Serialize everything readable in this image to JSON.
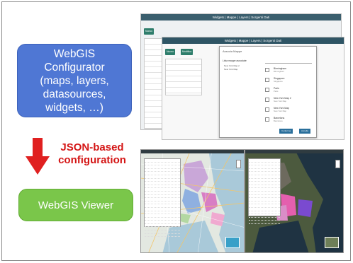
{
  "config_box": {
    "lines": [
      "WebGIS",
      "Configurator",
      "(maps, layers,",
      "datasources,",
      "widgets, …)"
    ]
  },
  "json_label": {
    "lines": [
      "JSON-based",
      "configuration"
    ]
  },
  "viewer_box": {
    "label": "WebGIS Viewer"
  },
  "colors": {
    "config_blue": "#4f77d4",
    "viewer_green": "#7ac64a",
    "arrow_red": "#e02020",
    "label_red": "#d41515"
  },
  "configurator_screenshot": {
    "back_nav": "Widgets | Mappe | Layers | Sorgenti Dati",
    "front_nav": "Widgets | Mappe | Layers | Sorgenti Dati",
    "dialog_title": "Associa Mappe",
    "dialog_left_heading": "Lista mappe associate",
    "dialog_left_items": [
      "New York Map 2",
      "New York Map"
    ],
    "dialog_items": [
      {
        "name": "Birmingham",
        "sub": "Birmingham"
      },
      {
        "name": "Singapore",
        "sub": "Singapore"
      },
      {
        "name": "Paris",
        "sub": "Paris"
      },
      {
        "name": "New York Map 2",
        "sub": "New York Map"
      },
      {
        "name": "New York Map",
        "sub": "New York Map"
      },
      {
        "name": "Barcelona",
        "sub": "Barcelona"
      }
    ],
    "confirm_label": "Conferma",
    "cancel_label": "Annulla",
    "back_button": "Nuovo",
    "front_buttons": [
      "Nuovo",
      "Modifica"
    ]
  }
}
